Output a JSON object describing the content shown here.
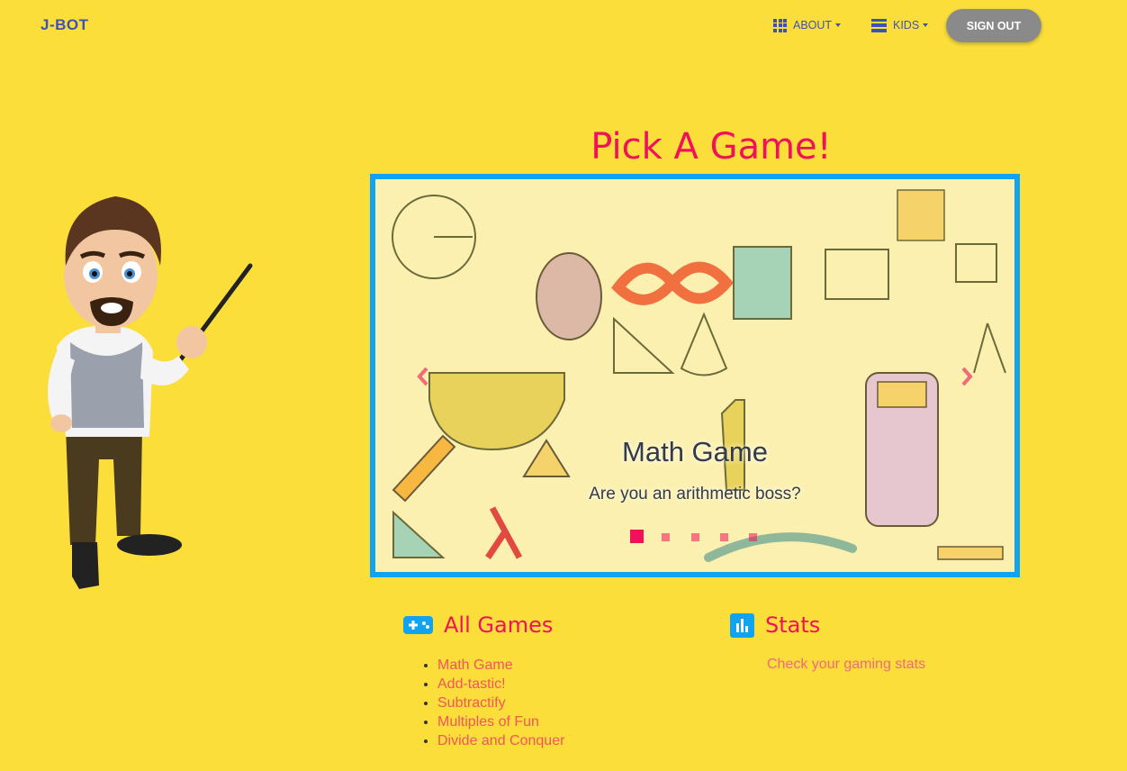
{
  "navbar": {
    "brand": "J-BOT",
    "about_label": "ABOUT",
    "about_icon": "grid-icon",
    "kids_label": "KIDS",
    "kids_icon": "list-icon",
    "signout_label": "SIGN OUT"
  },
  "page_title": "Pick A Game!",
  "carousel": {
    "slide_title": "Math Game",
    "slide_caption": "Are you an arithmetic boss?",
    "active_index": 0,
    "indicator_count": 5
  },
  "games_section": {
    "heading": "All Games",
    "icon": "gamepad-icon",
    "items": [
      "Math Game",
      "Add-tastic!",
      "Subtractify",
      "Multiples of Fun",
      "Divide and Conquer"
    ]
  },
  "stats_section": {
    "heading": "Stats",
    "icon": "bar-chart-icon",
    "link": "Check your gaming stats"
  },
  "colors": {
    "background": "#fbde3a",
    "accent": "#f0115a",
    "brand": "#3f51b5",
    "carousel_border": "#10a3f0"
  }
}
